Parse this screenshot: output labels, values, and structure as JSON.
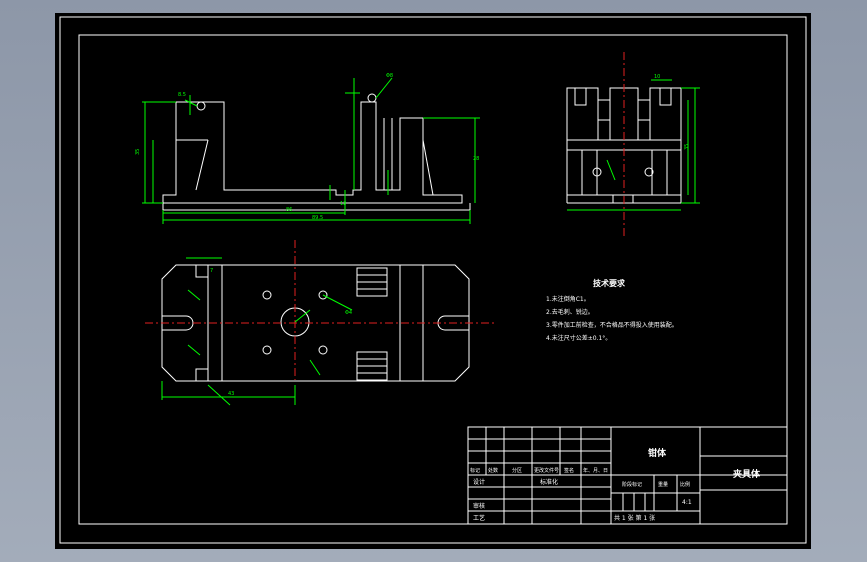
{
  "notes": {
    "heading": "技术要求",
    "items": [
      "1.未注倒角C1。",
      "2.去毛刺、锐边。",
      "3.零件加工前检查，不合格品不得投入使用装配。",
      "4.未注尺寸公差±0.1°。"
    ]
  },
  "title_block": {
    "part_name": "钳体",
    "drawing_name": "夹具体",
    "col_labels": [
      "标记",
      "处数",
      "分区",
      "更改文件号",
      "签名",
      "年、月、日"
    ],
    "row_labels": [
      "设计",
      "审核",
      "工艺"
    ],
    "std_label": "标准化",
    "stage_label": "阶段标记",
    "weight_label": "重量",
    "scale_label": "比例",
    "scale_value": "4:1",
    "sheet_info": "共 1 张  第 1 张"
  }
}
